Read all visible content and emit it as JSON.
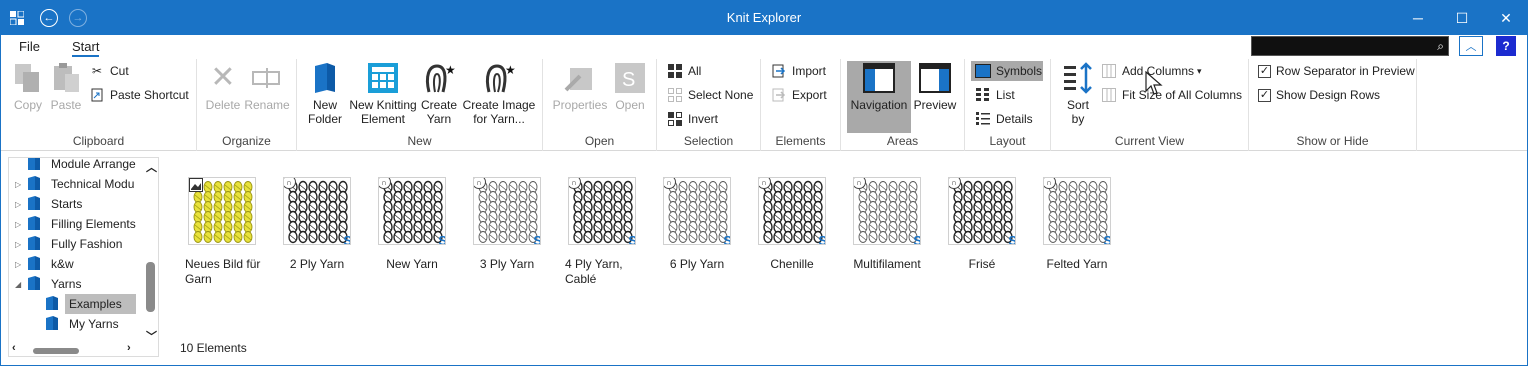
{
  "window": {
    "title": "Knit Explorer"
  },
  "colors": {
    "accent": "#1a73c6",
    "help": "#1c2bd0",
    "yarn_yellow": "#e8e23a"
  },
  "menu": {
    "file": "File",
    "start": "Start"
  },
  "ribbon": {
    "clipboard": {
      "label": "Clipboard",
      "copy": "Copy",
      "paste": "Paste",
      "cut": "Cut",
      "paste_shortcut": "Paste Shortcut"
    },
    "organize": {
      "label": "Organize",
      "delete": "Delete",
      "rename": "Rename"
    },
    "new": {
      "label": "New",
      "new_folder": "New Folder",
      "new_knitting_element": "New Knitting Element",
      "create_yarn": "Create Yarn",
      "create_image": "Create Image for Yarn..."
    },
    "open": {
      "label": "Open",
      "properties": "Properties",
      "open": "Open"
    },
    "selection": {
      "label": "Selection",
      "all": "All",
      "select_none": "Select None",
      "invert": "Invert"
    },
    "elements": {
      "label": "Elements",
      "import": "Import",
      "export": "Export"
    },
    "areas": {
      "label": "Areas",
      "navigation": "Navigation",
      "preview": "Preview"
    },
    "layout": {
      "label": "Layout",
      "symbols": "Symbols",
      "list": "List",
      "details": "Details"
    },
    "current_view": {
      "label": "Current View",
      "sort_by": "Sort by",
      "add_columns": "Add Columns",
      "fit_size": "Fit Size of All Columns"
    },
    "show_hide": {
      "label": "Show or Hide",
      "row_separator": "Row Separator in Preview",
      "show_design_rows": "Show Design Rows",
      "row_separator_checked": true,
      "show_design_rows_checked": true
    }
  },
  "tree": {
    "items": [
      {
        "label": "Module Arrange",
        "indent": 0,
        "expandable": false
      },
      {
        "label": "Technical Modu",
        "indent": 0,
        "expandable": true
      },
      {
        "label": "Starts",
        "indent": 0,
        "expandable": true
      },
      {
        "label": "Filling Elements",
        "indent": 0,
        "expandable": true
      },
      {
        "label": "Fully Fashion",
        "indent": 0,
        "expandable": true
      },
      {
        "label": "k&w",
        "indent": 0,
        "expandable": true
      },
      {
        "label": "Yarns",
        "indent": 0,
        "expandable": "open"
      },
      {
        "label": "Examples",
        "indent": 1,
        "selected": true
      },
      {
        "label": "My Yarns",
        "indent": 1
      }
    ]
  },
  "content": {
    "items": [
      {
        "name": "Neues Bild für Garn",
        "kind": "image"
      },
      {
        "name": "2 Ply Yarn",
        "kind": "yarn"
      },
      {
        "name": "New Yarn",
        "kind": "yarn"
      },
      {
        "name": "3 Ply Yarn",
        "kind": "yarn"
      },
      {
        "name": "4 Ply Yarn, Cablé",
        "kind": "yarn"
      },
      {
        "name": "6 Ply Yarn",
        "kind": "yarn"
      },
      {
        "name": "Chenille",
        "kind": "yarn"
      },
      {
        "name": "Multifilament",
        "kind": "yarn"
      },
      {
        "name": "Frisé",
        "kind": "yarn"
      },
      {
        "name": "Felted Yarn",
        "kind": "yarn"
      }
    ],
    "status": "10 Elements"
  }
}
